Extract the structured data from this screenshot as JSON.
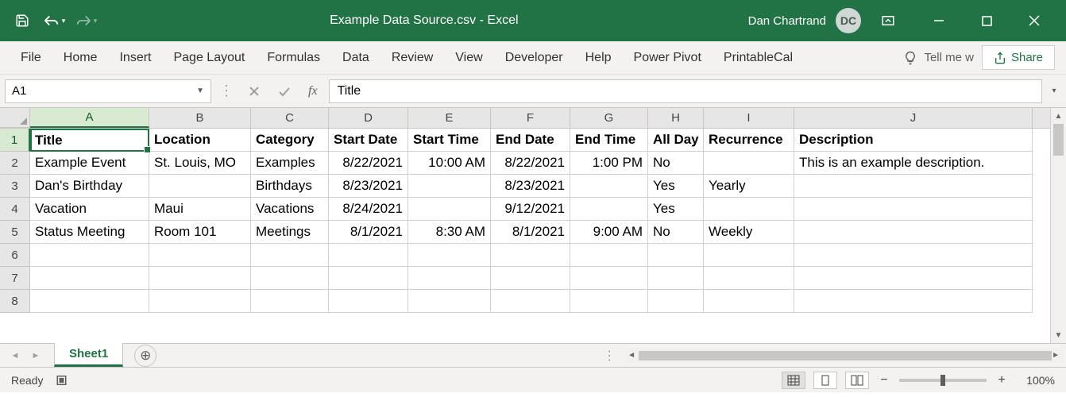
{
  "titlebar": {
    "filename": "Example Data Source.csv",
    "app": "Excel",
    "separator": "  -  ",
    "user_name": "Dan Chartrand",
    "user_initials": "DC"
  },
  "ribbon": {
    "tabs": [
      "File",
      "Home",
      "Insert",
      "Page Layout",
      "Formulas",
      "Data",
      "Review",
      "View",
      "Developer",
      "Help",
      "Power Pivot",
      "PrintableCal"
    ],
    "tell_me": "Tell me w",
    "share": "Share"
  },
  "formula_bar": {
    "name_box": "A1",
    "formula": "Title"
  },
  "grid": {
    "columns": [
      "A",
      "B",
      "C",
      "D",
      "E",
      "F",
      "G",
      "H",
      "I",
      "J"
    ],
    "active_col": "A",
    "active_row": "1",
    "row_count": 8,
    "headers": {
      "A": "Title",
      "B": "Location",
      "C": "Category",
      "D": "Start Date",
      "E": "Start Time",
      "F": "End Date",
      "G": "End Time",
      "H": "All Day",
      "I": "Recurrence",
      "J": "Description"
    },
    "rows": [
      {
        "A": "Example Event",
        "B": "St. Louis, MO",
        "C": "Examples",
        "D": "8/22/2021",
        "E": "10:00 AM",
        "F": "8/22/2021",
        "G": "1:00 PM",
        "H": "No",
        "I": "",
        "J": "This is an example description."
      },
      {
        "A": "Dan's Birthday",
        "B": "",
        "C": "Birthdays",
        "D": "8/23/2021",
        "E": "",
        "F": "8/23/2021",
        "G": "",
        "H": "Yes",
        "I": "Yearly",
        "J": ""
      },
      {
        "A": "Vacation",
        "B": "Maui",
        "C": "Vacations",
        "D": "8/24/2021",
        "E": "",
        "F": "9/12/2021",
        "G": "",
        "H": "Yes",
        "I": "",
        "J": ""
      },
      {
        "A": "Status Meeting",
        "B": "Room 101",
        "C": "Meetings",
        "D": "8/1/2021",
        "E": "8:30 AM",
        "F": "8/1/2021",
        "G": "9:00 AM",
        "H": "No",
        "I": "Weekly",
        "J": ""
      }
    ]
  },
  "sheets": {
    "active": "Sheet1"
  },
  "status": {
    "ready": "Ready",
    "zoom": "100%"
  }
}
